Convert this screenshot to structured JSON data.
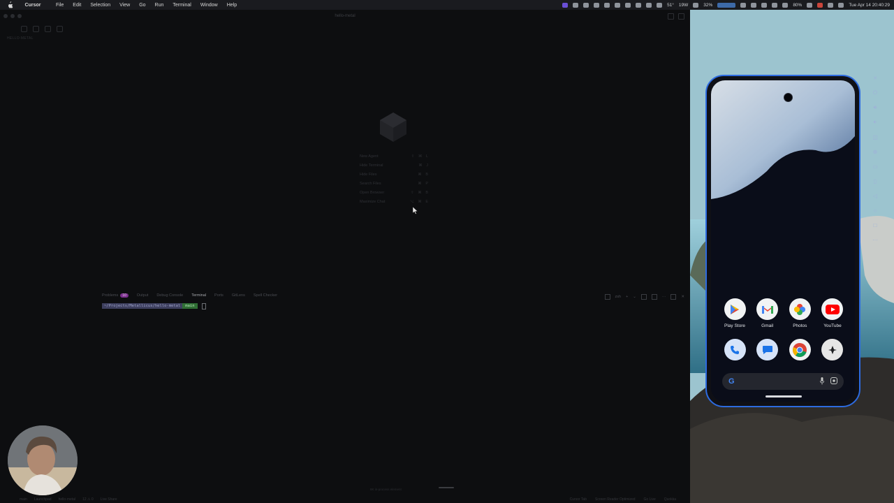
{
  "menubar": {
    "app_name": "Cursor",
    "items": [
      "File",
      "Edit",
      "Selection",
      "View",
      "Go",
      "Run",
      "Terminal",
      "Window",
      "Help"
    ],
    "weather": "51°",
    "wattage": "19W",
    "network": "32%",
    "battery": "80%",
    "clock": "Tue Apr 14  20:40:29"
  },
  "editor": {
    "window_title": "hello-metal",
    "explorer_label": "HELLO-METAL",
    "shortcuts": [
      {
        "label": "New Agent",
        "keys": "⇧ ⌘ L"
      },
      {
        "label": "Hide Terminal",
        "keys": "⌘ J"
      },
      {
        "label": "Hide Files",
        "keys": "⌘ B"
      },
      {
        "label": "Search Files",
        "keys": "⌘ P"
      },
      {
        "label": "Open Browser",
        "keys": "⇧ ⌘ B"
      },
      {
        "label": "Maximize Chat",
        "keys": "⌥ ⌘ E"
      }
    ],
    "panel": {
      "tabs": [
        "Problems",
        "Output",
        "Debug Console",
        "Terminal",
        "Ports",
        "GitLens",
        "Spell Checker"
      ],
      "active_tab": "Terminal",
      "problems_count": "10",
      "shell": "zsh",
      "terminal_path": "~/Projects/Metallicus/hello-metal",
      "terminal_branch": "main"
    },
    "statusbar": {
      "left": [
        "main",
        "Launchpad",
        "hello-metal",
        "12 ⚠ 0",
        "Live Share"
      ],
      "center": "8K in-process element",
      "right": [
        "Cursor Tab",
        "Screen Reader Optimized",
        "Go Live",
        "Quokka"
      ]
    }
  },
  "phone": {
    "apps_row1": [
      {
        "label": "Play Store",
        "icon": "play-store-icon"
      },
      {
        "label": "Gmail",
        "icon": "gmail-icon"
      },
      {
        "label": "Photos",
        "icon": "photos-icon"
      },
      {
        "label": "YouTube",
        "icon": "youtube-icon"
      }
    ],
    "apps_row2": [
      {
        "icon": "phone-icon"
      },
      {
        "icon": "messages-icon"
      },
      {
        "icon": "chrome-icon"
      },
      {
        "icon": "settings-app-icon"
      }
    ],
    "search_logo": "G"
  },
  "colors": {
    "accent": "#2d6be0",
    "problems_badge": "#7a2e8c",
    "branch_green": "#2f6e34"
  }
}
